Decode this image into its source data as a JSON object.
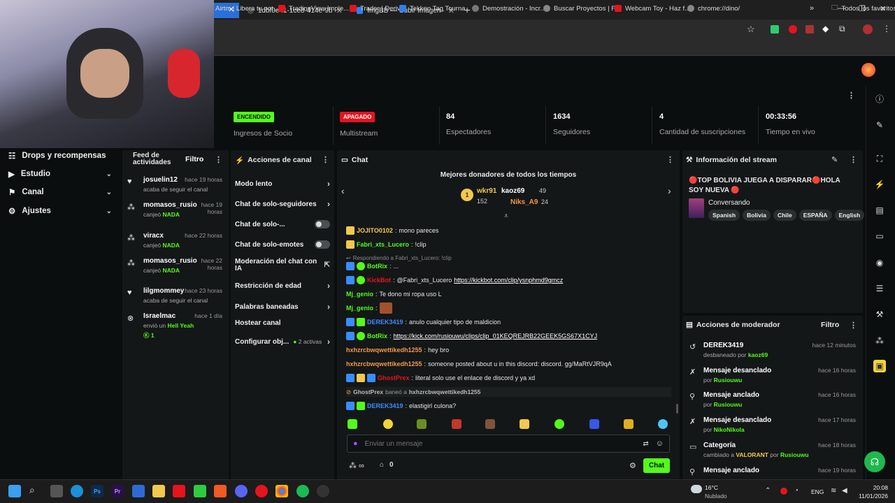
{
  "browser": {
    "tabs": [
      {
        "title": "1dbf0e41-1ce8-414e-9bbe-5ea",
        "icon": "globe-icon"
      },
      {
        "title": "ImgBB — Subir Imagen — Alojami",
        "icon": "imgbb-icon"
      }
    ],
    "bookmarks": [
      "Airtm | Libera tu pot...",
      "TradingView Imple...",
      "Trader | Deriv",
      "Tekken Tag Tourna...",
      "Demostración - Incr...",
      "Buscar Proyectos | F...",
      "Webcam Toy - Haz f...",
      "chrome://dino/"
    ],
    "all_bookmarks": "Todos los favoritos"
  },
  "stats": [
    {
      "value": "ENCENDIDO",
      "label": "Ingresos de Socio",
      "pill": true,
      "color": "#53fc18"
    },
    {
      "value": "APAGADO",
      "label": "Multistream",
      "pill": true,
      "color": "#e5141d"
    },
    {
      "value": "84",
      "label": "Espectadores"
    },
    {
      "value": "1634",
      "label": "Seguidores"
    },
    {
      "value": "4",
      "label": "Cantidad de suscripciones"
    },
    {
      "value": "00:33:56",
      "label": "Tiempo en vivo"
    }
  ],
  "leftnav": [
    {
      "label": "Drops y recompensas",
      "icon": "gift-icon",
      "chevron": false
    },
    {
      "label": "Estudio",
      "icon": "video-icon",
      "chevron": true
    },
    {
      "label": "Canal",
      "icon": "channel-icon",
      "chevron": true
    },
    {
      "label": "Ajustes",
      "icon": "gear-icon",
      "chevron": true
    }
  ],
  "feed": {
    "title": "Feed de actividades",
    "filter": "Filtro",
    "items": [
      {
        "name": "josuelin12",
        "time": "hace 19 horas",
        "sub": "acaba de seguir el canal",
        "icon": "heart-icon"
      },
      {
        "name": "momasos_rusio",
        "time": "hace 19 horas",
        "sub": "canjeó",
        "reward": "NADA",
        "icon": "points-icon"
      },
      {
        "name": "viracx",
        "time": "hace 22 horas",
        "sub": "canjeó",
        "reward": "NADA",
        "icon": "points-icon"
      },
      {
        "name": "momasos_rusio",
        "time": "hace 22 horas",
        "sub": "canjeó",
        "reward": "NADA",
        "icon": "points-icon"
      },
      {
        "name": "lilgmommey",
        "time": "hace 23 horas",
        "sub": "acaba de seguir el canal",
        "icon": "heart-icon"
      },
      {
        "name": "Israelmac",
        "time": "hace 1 día",
        "sub": "envió un",
        "reward": "Hell Yeah",
        "count": "1",
        "icon": "kicks-icon"
      }
    ]
  },
  "actions": {
    "title": "Acciones de canal",
    "items": [
      {
        "label": "Modo lento",
        "type": "chevron"
      },
      {
        "label": "Chat de solo-seguidores",
        "type": "chevron"
      },
      {
        "label": "Chat de solo-...",
        "type": "toggle"
      },
      {
        "label": "Chat de solo-emotes",
        "type": "toggle"
      },
      {
        "label": "Moderación del chat con IA",
        "type": "external"
      },
      {
        "label": "Restricción de edad",
        "type": "chevron"
      },
      {
        "label": "Palabras baneadas",
        "type": "chevron"
      },
      {
        "label": "Hostear canal",
        "type": "none"
      },
      {
        "label": "Configurar obj...",
        "type": "chevron",
        "extra": "2 activas"
      }
    ]
  },
  "chat": {
    "title": "Chat",
    "donors_title": "Mejores donadores de todos los tiempos",
    "donors": [
      {
        "name": "wkr91",
        "amount": "152",
        "color": "#f2c94c"
      },
      {
        "name": "kaoz69",
        "amount": "49"
      },
      {
        "name": "Niks_A9",
        "amount": "24",
        "color": "#f2994a"
      }
    ],
    "messages": [
      {
        "user": "JOJITO0102",
        "color": "#f2c94c",
        "text": "mono pareces"
      },
      {
        "user": "Fabri_xts_Lucero",
        "color": "#53fc18",
        "text": "!clip"
      },
      {
        "reply": "Respondiendo a Fabri_xts_Lucero: !clip"
      },
      {
        "user": "BotRix",
        "color": "#53fc18",
        "text": "..."
      },
      {
        "user": "KickBot",
        "color": "#e5141d",
        "text": "@Fabri_xts_Lucero",
        "link": "https://kickbot.com/clip/ysnphmd9gmcz"
      },
      {
        "user": "Mj_genio",
        "color": "#53fc18",
        "text": "Te dono mi ropa uso L"
      },
      {
        "user": "Mj_genio",
        "color": "#53fc18",
        "text": ""
      },
      {
        "user": "DEREK3419",
        "color": "#3a8dff",
        "text": "anulo cualquier tipo de maldicion"
      },
      {
        "user": "BotRix",
        "color": "#53fc18",
        "text": "",
        "link": "https://kick.com/rusiouwu/clips/clip_01KEQREJRB22GEEK5GS67X1CYJ"
      },
      {
        "user": "hxhzrcbwqwettikedh1255",
        "color": "#f2994a",
        "text": "hey bro"
      },
      {
        "user": "hxhzrcbwqwettikedh1255",
        "color": "#f2994a",
        "text": "someone posted about u in this discord: discord. gg/MaRtVJR9qA"
      },
      {
        "user": "GhostPrex",
        "color": "#e5141d",
        "text": "literal solo use el enlace de discord y ya xd"
      },
      {
        "ban": "GhostPrex",
        "ban_text": "baneó a",
        "target": "hxhzrcbwqwettikedh1255"
      },
      {
        "user": "DEREK3419",
        "color": "#3a8dff",
        "text": "elastigirl culona?"
      }
    ],
    "placeholder": "Enviar un mensaje",
    "points": "0",
    "send": "Chat"
  },
  "stream_info": {
    "title": "Información del stream",
    "stream_title": "🔴TOP BOLIVIA JUEGA A DISPARAR🔴HOLA SOY NUEVA 🔴",
    "category": "Conversando",
    "tags": [
      "Spanish",
      "Bolivia",
      "Chile",
      "ESPAÑA",
      "English"
    ]
  },
  "mod": {
    "title": "Acciones de moderador",
    "filter": "Filtro",
    "items": [
      {
        "name": "DEREK3419",
        "sub": "desbaneado por",
        "by": "kaoz69",
        "time": "hace 12 minutos",
        "icon": "undo-icon"
      },
      {
        "name": "Mensaje desanclado",
        "sub": "por",
        "by": "Rusiouwu",
        "time": "hace 16 horas",
        "icon": "unpin-icon"
      },
      {
        "name": "Mensaje anclado",
        "sub": "por",
        "by": "Rusiouwu",
        "time": "hace 16 horas",
        "icon": "pin-icon"
      },
      {
        "name": "Mensaje desanclado",
        "sub": "por",
        "by": "NikoNikola",
        "time": "hace 17 horas",
        "icon": "unpin-icon"
      },
      {
        "name": "Categoría",
        "sub": "cambiado a",
        "cat": "VALORANT",
        "sub2": "por",
        "by": "Rusiouwu",
        "time": "hace 18 horas",
        "icon": "category-icon"
      },
      {
        "name": "Mensaje anclado",
        "sub": "",
        "by": "",
        "time": "hace 19 horas",
        "icon": "pin-icon"
      }
    ]
  },
  "taskbar": {
    "weather_temp": "16°C",
    "weather_text": "Nublado",
    "lang": "ENG",
    "time": "20:08",
    "date": "11/01/2026"
  }
}
